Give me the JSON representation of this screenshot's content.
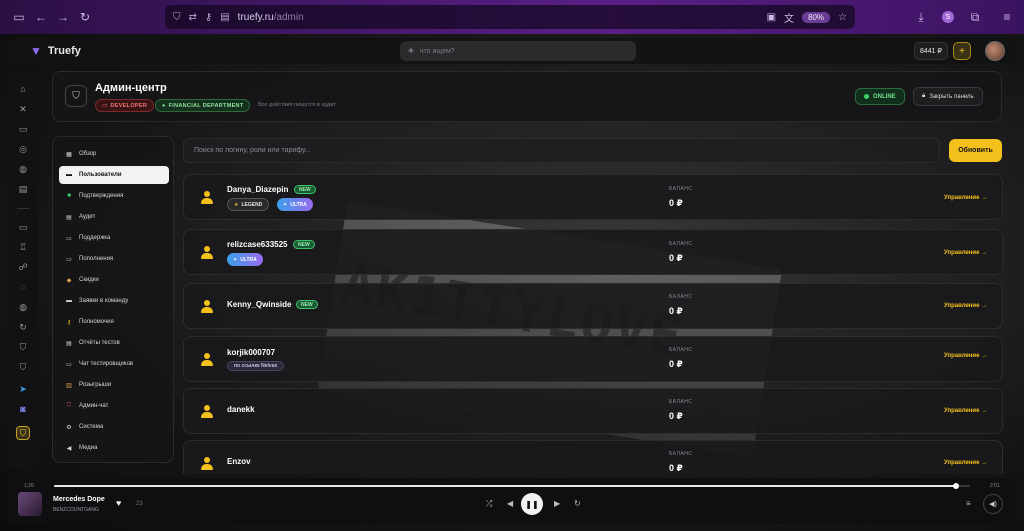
{
  "browser": {
    "url_host": "truefy.ru",
    "url_path": "/admin",
    "zoom": "80%"
  },
  "topbar": {
    "brand": "Truefy",
    "search_placeholder": "что ищем?",
    "balance": "8441 ₽",
    "add_label": "+"
  },
  "admin": {
    "title": "Админ-центр",
    "tag_developer": "DEVELOPER",
    "tag_financial": "FINANCIAL DEPARTMENT",
    "note": "Все действия пишутся в аудит",
    "online": "ONLINE",
    "close_panel": "Закрыть панель"
  },
  "sidebar": {
    "items": [
      {
        "label": "Обзор",
        "icon": "grid-icon"
      },
      {
        "label": "Пользователи",
        "icon": "users-icon"
      },
      {
        "label": "Подтверждения",
        "icon": "check-icon"
      },
      {
        "label": "Аудит",
        "icon": "audit-icon"
      },
      {
        "label": "Поддержка",
        "icon": "support-icon"
      },
      {
        "label": "Пополнения",
        "icon": "wallet-icon"
      },
      {
        "label": "Скидки",
        "icon": "tag-icon"
      },
      {
        "label": "Заявки в команду",
        "icon": "team-icon"
      },
      {
        "label": "Полномочия",
        "icon": "key-icon"
      },
      {
        "label": "Отчёты тестов",
        "icon": "report-icon"
      },
      {
        "label": "Чат тестировщиков",
        "icon": "chat-icon"
      },
      {
        "label": "Розыгрыши",
        "icon": "gift-icon"
      },
      {
        "label": "Админ-чат",
        "icon": "shield-icon"
      },
      {
        "label": "Система",
        "icon": "gear-icon"
      },
      {
        "label": "Медиа",
        "icon": "media-icon"
      }
    ]
  },
  "search": {
    "placeholder": "Поиск по логину, роли или тарифу...",
    "refresh": "Обновить"
  },
  "users": {
    "balance_label": "БАЛАНС",
    "manage_label": "Управление →",
    "new_label": "NEW",
    "rows": [
      {
        "name": "Danya_Diazepin",
        "balance": "0 ₽",
        "badge1": "LEGEND",
        "badge2": "ULTRA"
      },
      {
        "name": "relizcase633525",
        "balance": "0 ₽",
        "badge1": "ULTRA"
      },
      {
        "name": "Kenny_Qwinside",
        "balance": "0 ₽"
      },
      {
        "name": "korjik000707",
        "balance": "0 ₽",
        "badge1": "по ссылке Nelvax"
      },
      {
        "name": "danekk",
        "balance": "0 ₽"
      },
      {
        "name": "Enzov",
        "balance": "0 ₽"
      }
    ]
  },
  "player": {
    "current_time": "1:26",
    "total_time": "2:01",
    "progress": 0.985,
    "title": "Mercedes Dope",
    "artist": "BENZCOUNTGANG",
    "extra": "23"
  },
  "colors": {
    "accent": "#f4c01c",
    "purple": "#5b1f86",
    "online_green": "#6fe08f"
  }
}
